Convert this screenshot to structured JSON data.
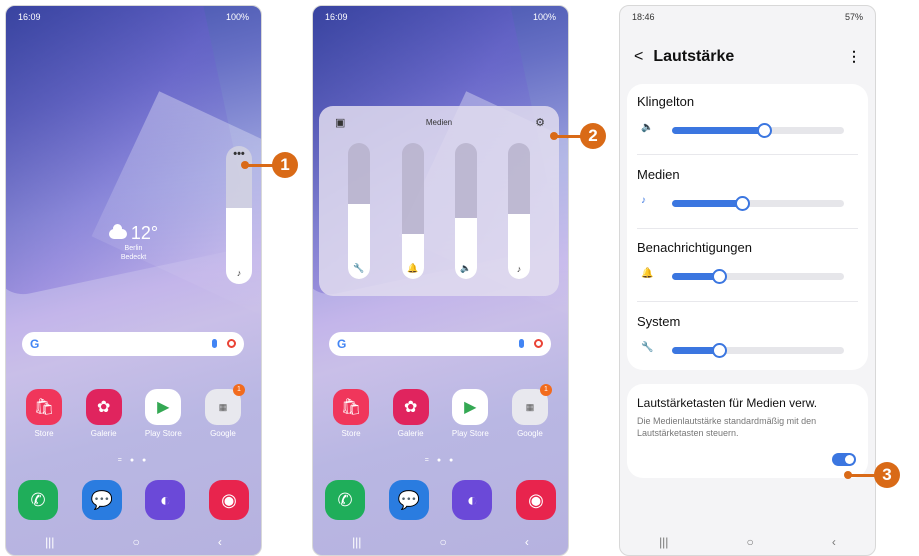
{
  "colors": {
    "accent": "#3b76e0",
    "callout": "#d96a17"
  },
  "screen1": {
    "status": {
      "time": "16:09",
      "right": "100%"
    },
    "weather": {
      "temp": "12°",
      "city": "Berlin",
      "condition": "Bedeckt"
    },
    "google": "G",
    "volume_level": 0.55,
    "apps": [
      {
        "label": "Store"
      },
      {
        "label": "Galerie"
      },
      {
        "label": "Play Store"
      },
      {
        "label": "Google",
        "badge": "1"
      }
    ],
    "callout": "1"
  },
  "screen2": {
    "status": {
      "time": "16:09",
      "right": "100%"
    },
    "panel_title": "Medien",
    "sliders": [
      {
        "icon": "wrench-icon",
        "level": 0.55
      },
      {
        "icon": "bell-icon",
        "level": 0.33
      },
      {
        "icon": "speaker-icon",
        "level": 0.45
      },
      {
        "icon": "music-note-icon",
        "level": 0.48
      }
    ],
    "google": "G",
    "apps": [
      {
        "label": "Store"
      },
      {
        "label": "Galerie"
      },
      {
        "label": "Play Store"
      },
      {
        "label": "Google",
        "badge": "1"
      }
    ],
    "callout": "2"
  },
  "screen3": {
    "status": {
      "time": "18:46",
      "right": "57%"
    },
    "title": "Lautstärke",
    "rows": [
      {
        "label": "Klingelton",
        "level": 0.53
      },
      {
        "label": "Medien",
        "level": 0.4
      },
      {
        "label": "Benachrichtigungen",
        "level": 0.27
      },
      {
        "label": "System",
        "level": 0.27
      }
    ],
    "option_title": "Lautstärketasten für Medien verw.",
    "option_desc": "Die Medienlautstärke standardmäßig mit den Lautstärketasten steuern.",
    "toggle_on": true,
    "callout": "3"
  }
}
